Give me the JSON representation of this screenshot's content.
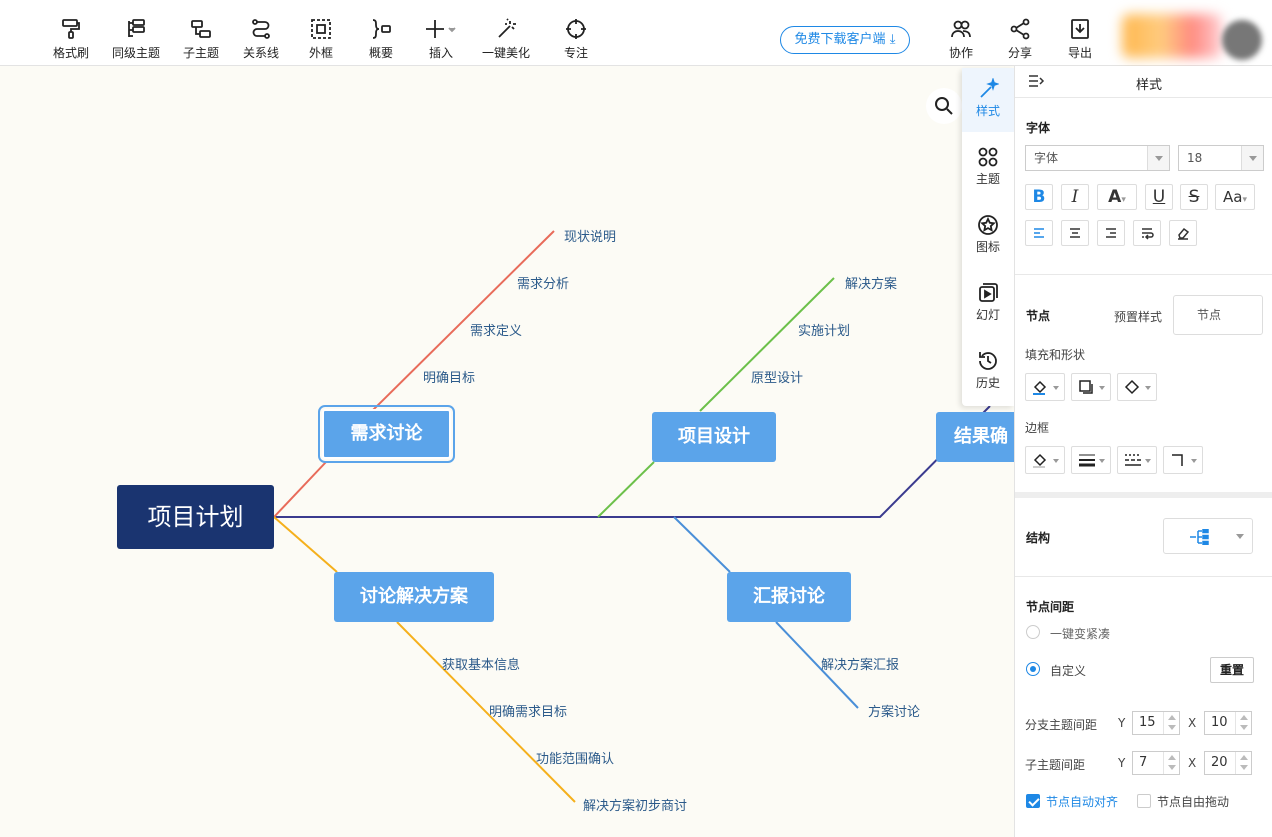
{
  "toolbar": {
    "format_brush": "格式刷",
    "sibling_topic": "同级主题",
    "subtopic": "子主题",
    "relation_line": "关系线",
    "boundary": "外框",
    "summary": "概要",
    "insert": "插入",
    "beautify": "一键美化",
    "focus": "专注",
    "download": "免费下载客户端",
    "collaborate": "协作",
    "share": "分享",
    "export": "导出"
  },
  "mindmap": {
    "root": "项目计划",
    "branches": {
      "requirements": {
        "title": "需求讨论",
        "color": "#e86b5a",
        "children": [
          "现状说明",
          "需求分析",
          "需求定义",
          "明确目标"
        ]
      },
      "design": {
        "title": "项目设计",
        "color": "#6cc04a",
        "children": [
          "解决方案",
          "实施计划",
          "原型设计"
        ]
      },
      "result": {
        "title": "结果确",
        "color": "#3b3b8f"
      },
      "solution": {
        "title": "讨论解决方案",
        "color": "#f5b01c",
        "children": [
          "获取基本信息",
          "明确需求目标",
          "功能范围确认",
          "解决方案初步商讨"
        ]
      },
      "report": {
        "title": "汇报讨论",
        "color": "#4a8fd8",
        "children": [
          "解决方案汇报",
          "方案讨论"
        ]
      }
    },
    "spine_color": "#3b3b8f"
  },
  "side_nav": {
    "style": "样式",
    "theme": "主题",
    "icon": "图标",
    "slides": "幻灯",
    "history": "历史"
  },
  "panel": {
    "title": "样式",
    "font_section": "字体",
    "font_family": "字体",
    "font_size": "18",
    "node_section": "节点",
    "preset_style_label": "预置样式",
    "preset_style_value": "节点",
    "fill_shape_label": "填充和形状",
    "border_label": "边框",
    "structure_label": "结构",
    "spacing_section": "节点间距",
    "compact_label": "一键变紧凑",
    "custom_label": "自定义",
    "reset_button": "重置",
    "branch_spacing_label": "分支主题间距",
    "branch_y": "15",
    "branch_x": "10",
    "sub_spacing_label": "子主题间距",
    "sub_y": "7",
    "sub_x": "20",
    "y_label": "Y",
    "x_label": "X",
    "auto_align_label": "节点自动对齐",
    "free_drag_label": "节点自由拖动"
  },
  "colors": {
    "accent": "#1e88e5",
    "node_blue": "#5ba4ea",
    "root_navy": "#1a3470"
  }
}
